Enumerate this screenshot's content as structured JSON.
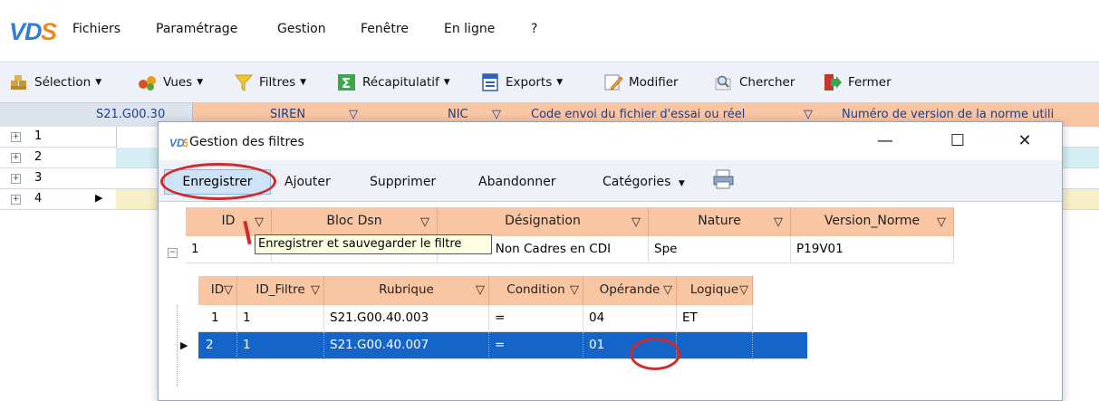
{
  "app": {
    "logo_text": "VDS",
    "menu": [
      "Fichiers",
      "Paramétrage",
      "Gestion",
      "Fenêtre",
      "En ligne",
      "?"
    ]
  },
  "toolbar": {
    "selection": "Sélection",
    "vues": "Vues",
    "filtres": "Filtres",
    "recap": "Récapitulatif",
    "exports": "Exports",
    "modifier": "Modifier",
    "chercher": "Chercher",
    "fermer": "Fermer"
  },
  "background_grid": {
    "corner_label": "S21.G00.30",
    "columns": [
      "SIREN",
      "NIC",
      "Code envoi du fichier d'essai ou réel",
      "Numéro de version de la norme utili"
    ],
    "rows": [
      "1",
      "2",
      "3",
      "4"
    ]
  },
  "dialog": {
    "title": "Gestion des filtres",
    "buttons": {
      "enregistrer": "Enregistrer",
      "ajouter": "Ajouter",
      "supprimer": "Supprimer",
      "abandonner": "Abandonner",
      "categories": "Catégories"
    },
    "tooltip": "Enregistrer et sauvegarder le filtre",
    "grid": {
      "columns": [
        "ID",
        "Bloc Dsn",
        "Désignation",
        "Nature",
        "Version_Norme"
      ],
      "row": {
        "id": "1",
        "bloc": "",
        "designation": "Salariés Non Cadres en CDI",
        "nature": "Spe",
        "version": "P19V01"
      }
    },
    "detail": {
      "columns": [
        "ID",
        "ID_Filtre",
        "Rubrique",
        "Condition",
        "Opérande",
        "Logique"
      ],
      "rows": [
        {
          "id": "1",
          "id_filtre": "1",
          "rubrique": "S21.G00.40.003",
          "condition": "=",
          "operande": "04",
          "logique": "ET"
        },
        {
          "id": "2",
          "id_filtre": "1",
          "rubrique": "S21.G00.40.007",
          "condition": "=",
          "operande": "01",
          "logique": ""
        }
      ]
    }
  },
  "colors": {
    "header_orange": "#f9c6a4",
    "selection_blue": "#1565c8",
    "annotation_red": "#d22a2a",
    "tooltip_bg": "#ffffe1"
  }
}
